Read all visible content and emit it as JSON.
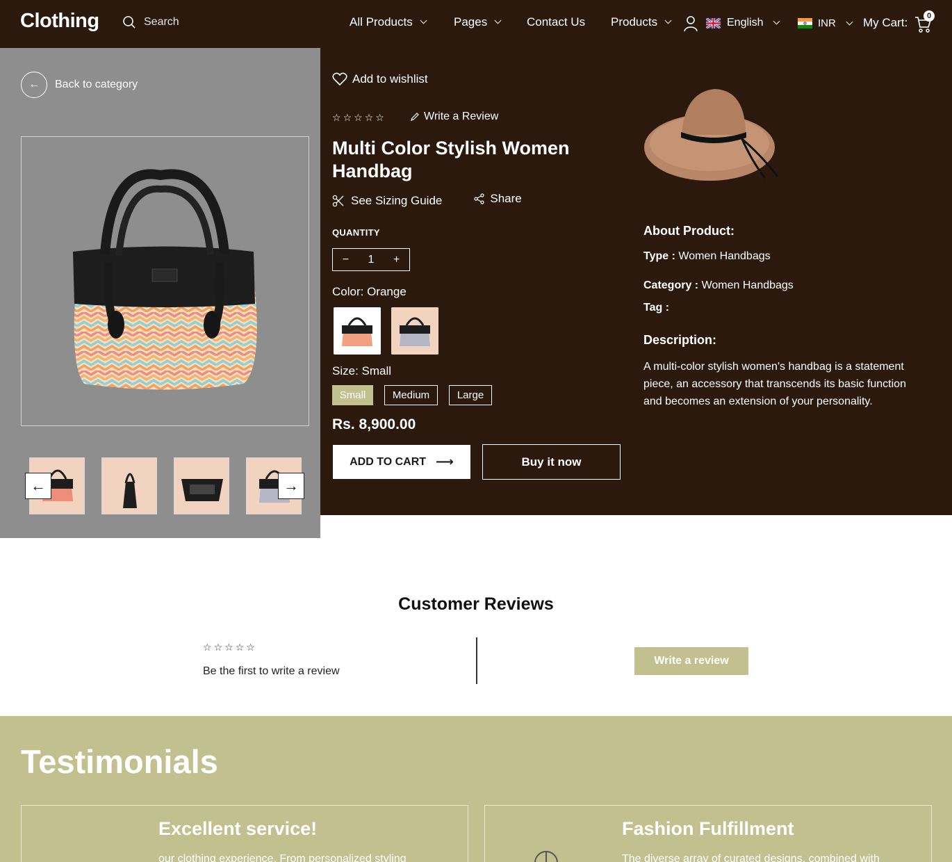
{
  "header": {
    "logo": "Clothing",
    "search_placeholder": "Search",
    "nav": {
      "all_products": "All Products",
      "pages": "Pages",
      "contact": "Contact Us",
      "products": "Products",
      "language": "English",
      "currency": "INR",
      "cart_label": "My Cart:",
      "cart_count": "0"
    }
  },
  "gallery": {
    "back_label": "Back to category",
    "prev_arrow": "←",
    "next_arrow": "→"
  },
  "product": {
    "wishlist": "Add to wishlist",
    "write_review": "Write a Review",
    "title": "Multi Color Stylish Women Handbag",
    "sizing_guide": "See Sizing Guide",
    "share": "Share",
    "quantity_label": "QUANTITY",
    "quantity_minus": "−",
    "quantity_value": "1",
    "quantity_plus": "+",
    "color_label": "Color: Orange",
    "size_label": "Size: Small",
    "sizes": [
      "Small",
      "Medium",
      "Large"
    ],
    "price": "Rs. 8,900.00",
    "add_to_cart": "ADD TO CART",
    "buy_now": "Buy it now",
    "about_heading": "About Product:",
    "type_label": "Type :",
    "type_value": "Women Handbags",
    "category_label": "Category :",
    "category_value": "Women Handbags",
    "tag_label": "Tag :",
    "description_heading": "Description:",
    "description": "A multi-color stylish women's handbag is a statement piece, an accessory that transcends its basic function and becomes an extension of your personality."
  },
  "reviews": {
    "title": "Customer Reviews",
    "empty_text": "Be the first to write a review",
    "write_button": "Write a review"
  },
  "testimonials": {
    "title": "Testimonials",
    "cards": [
      {
        "title": "Excellent service!",
        "text": "our clothing experience. From personalized styling"
      },
      {
        "title": "Fashion Fulfillment",
        "text": "The diverse array of curated designs, combined with"
      }
    ]
  },
  "colors": {
    "header_bg": "#2b190e",
    "gallery_bg": "#8e8e8e",
    "accent_olive": "#c3c08f",
    "selected_size": "#c3c08f"
  }
}
